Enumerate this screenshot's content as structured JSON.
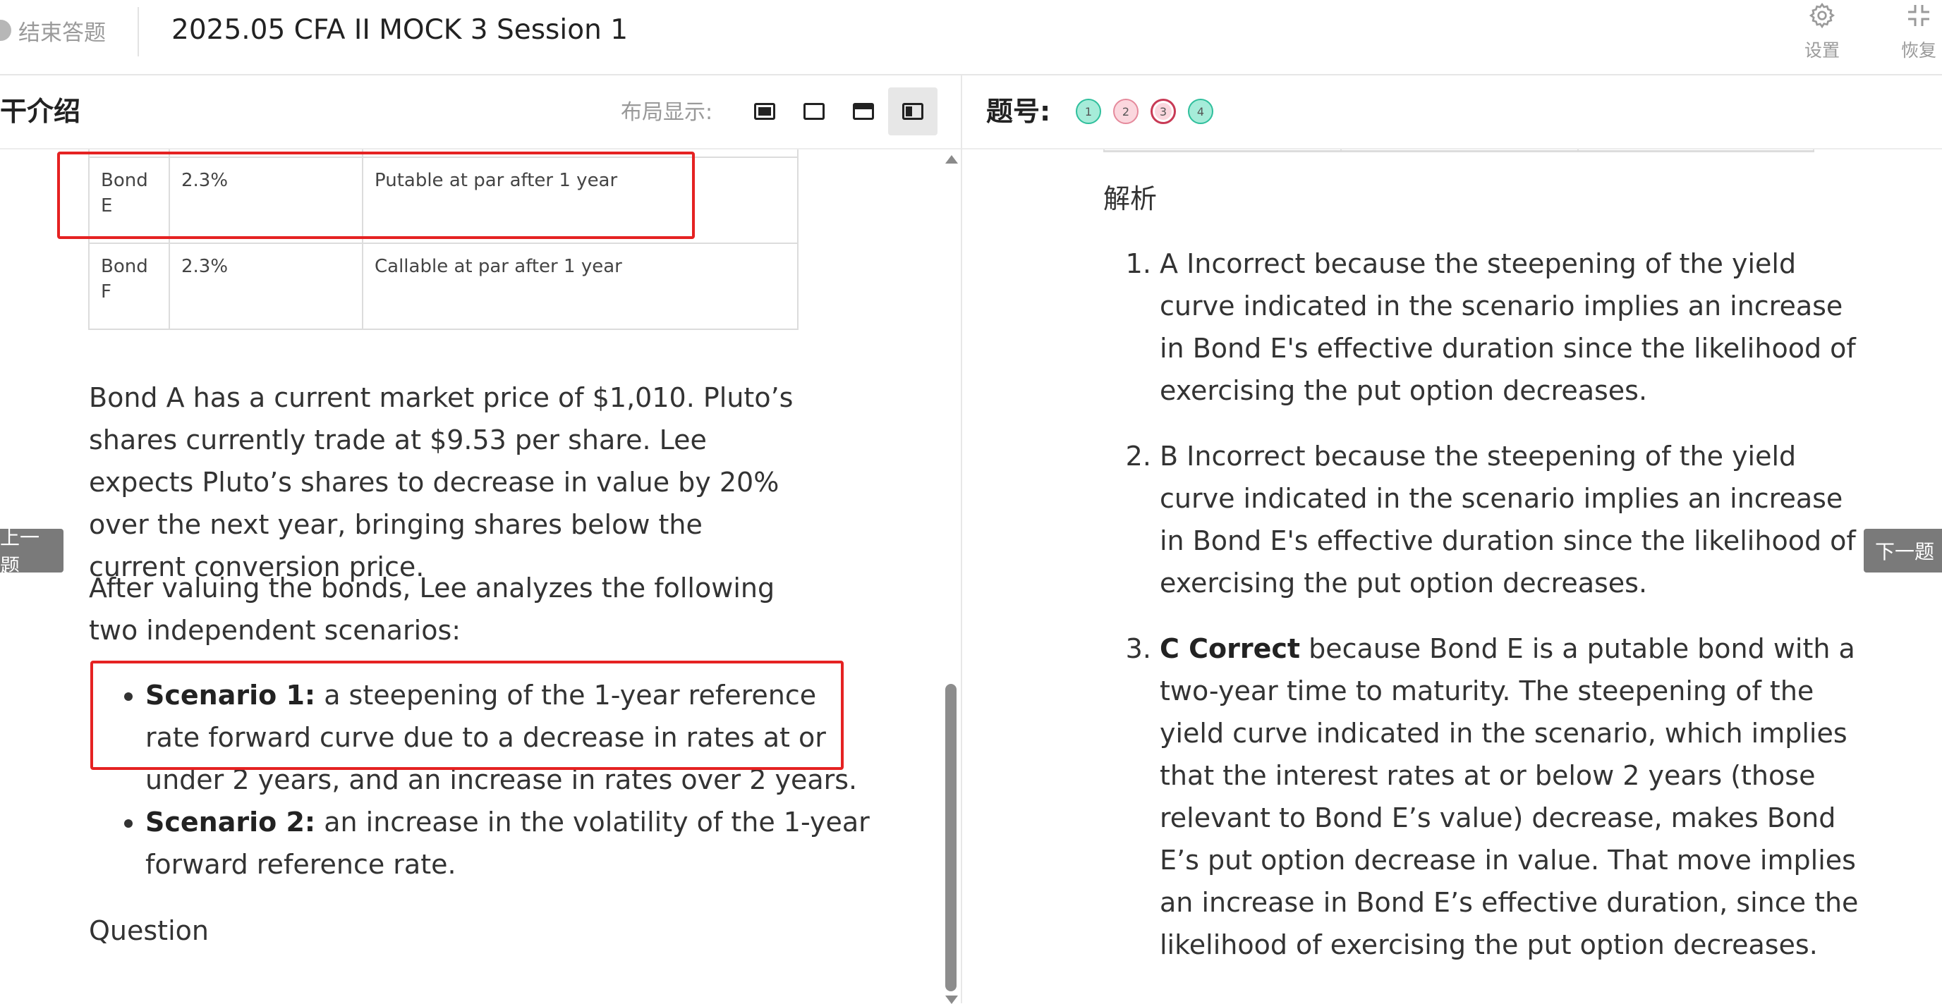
{
  "topbar": {
    "end_exam": "结束答题",
    "title": "2025.05 CFA II MOCK 3 Session 1",
    "settings_label": "设置",
    "restore_label": "恢复"
  },
  "left": {
    "header_title": "干介绍",
    "layout_label": "布局显示:",
    "table_rows": [
      {
        "bond": "Bond E",
        "rate": "2.3%",
        "feature": "Putable at par after 1 year"
      },
      {
        "bond": "Bond F",
        "rate": "2.3%",
        "feature": "Callable at par after 1 year"
      }
    ],
    "para1": "Bond A has a current market price of $1,010. Pluto’s shares currently trade at $9.53 per share. Lee expects Pluto’s shares to decrease in value by 20% over the next year, bringing shares below the current conversion price.",
    "para2": "After valuing the bonds, Lee analyzes the following two independent scenarios:",
    "scenarios": [
      {
        "label": "Scenario 1:",
        "text": " a steepening of the 1-year reference rate forward curve due to a decrease in rates at or under 2 years, and an increase in rates over 2 years."
      },
      {
        "label": "Scenario 2:",
        "text": " an increase in the volatility of the 1-year forward reference rate."
      }
    ],
    "question_label": "Question"
  },
  "nav": {
    "prev": "上一题",
    "next": "下一题"
  },
  "right": {
    "qno_label": "题号:",
    "questions": [
      "1",
      "2",
      "3",
      "4"
    ],
    "current_question": "3",
    "analysis_title": "解析",
    "answers": [
      {
        "prefix": "",
        "lead": "A Incorrect because the steepening of the yield curve indicated in the scenario implies an increase in Bond E's effective duration since the likelihood of exercising the put option decreases."
      },
      {
        "prefix": "",
        "lead": "B Incorrect because the steepening of the yield curve indicated in the scenario implies an increase in Bond E's effective duration since the likelihood of exercising the put option decreases."
      },
      {
        "prefix": "C Correct",
        "lead": " because Bond E is a putable bond with a two-year time to maturity. The steepening of the yield curve indicated in the scenario, which implies that the interest rates at or below 2 years (those relevant to Bond E’s value) decrease, makes Bond E’s put option decrease in value. That move implies an increase in Bond E’s effective duration, since the likelihood of exercising the put option decreases."
      }
    ]
  },
  "colors": {
    "highlight_box": "#e52222",
    "answered_green": "#a6ecd9",
    "answered_pink": "#fbd7de"
  }
}
